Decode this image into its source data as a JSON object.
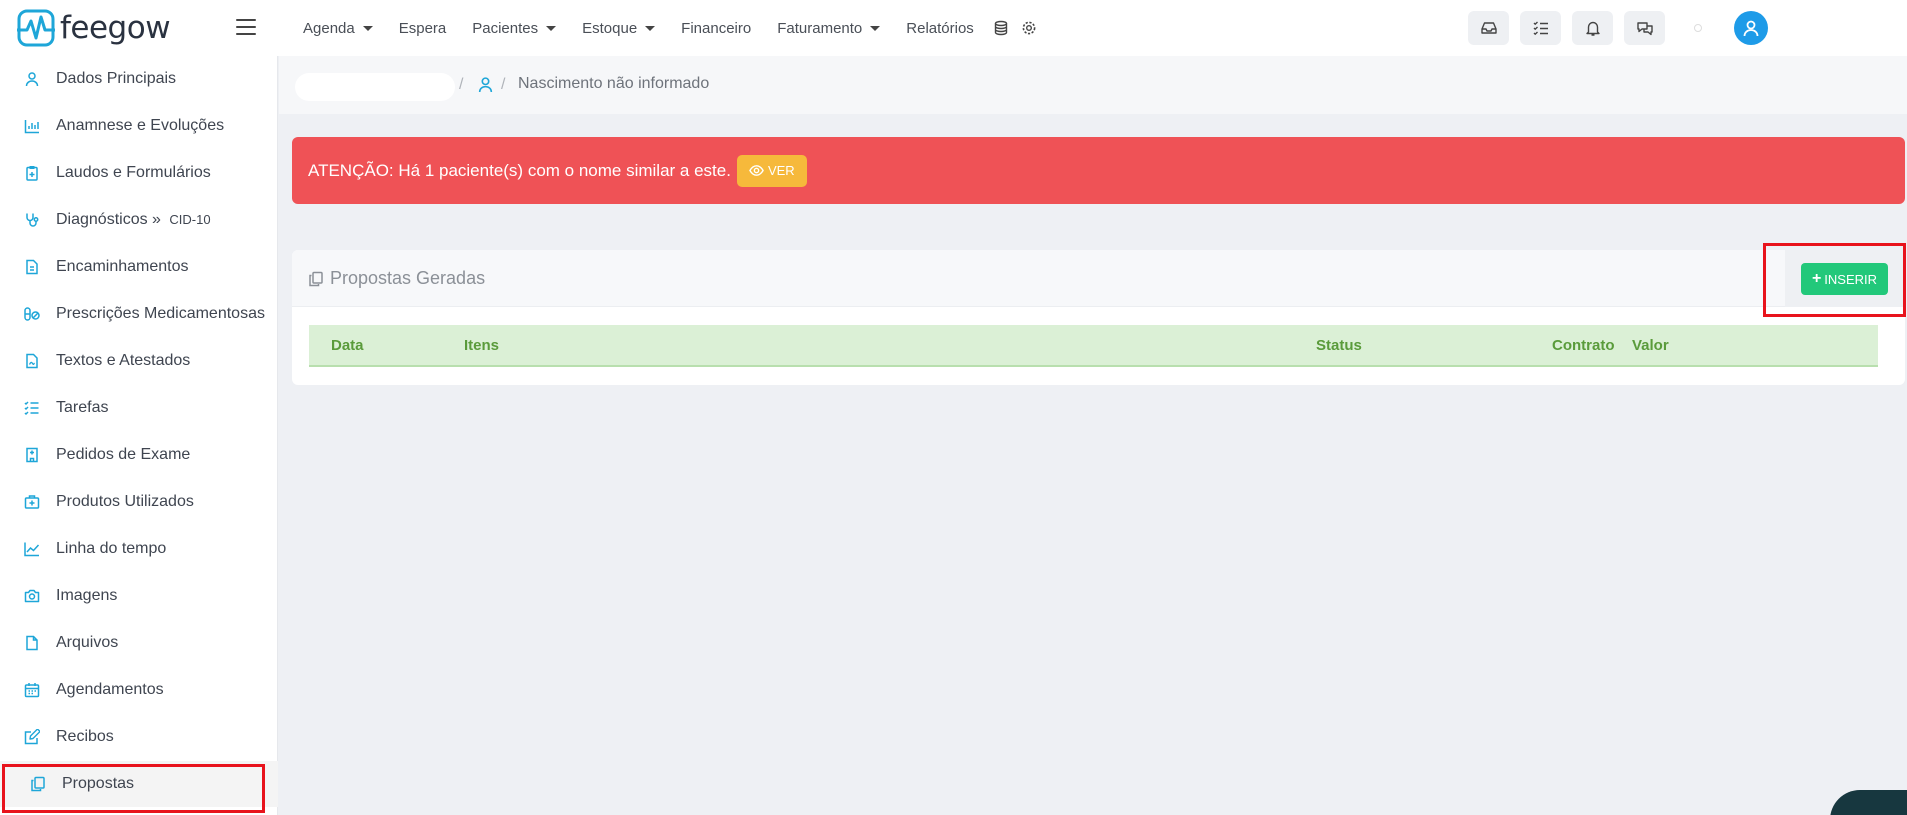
{
  "app": {
    "logo_text": "feegow",
    "brand_color": "#1ea6d8"
  },
  "nav": {
    "agenda": "Agenda",
    "espera": "Espera",
    "pacientes": "Pacientes",
    "estoque": "Estoque",
    "financeiro": "Financeiro",
    "faturamento": "Faturamento",
    "relatorios": "Relatórios"
  },
  "sidebar": {
    "items": [
      {
        "label": "Dados Principais",
        "icon": "user-icon"
      },
      {
        "label": "Anamnese e Evoluções",
        "icon": "chart-bar-icon"
      },
      {
        "label": "Laudos e Formulários",
        "icon": "clipboard-icon"
      },
      {
        "label": "Diagnósticos » ",
        "suffix": "CID-10",
        "icon": "stethoscope-icon"
      },
      {
        "label": "Encaminhamentos",
        "icon": "file-icon"
      },
      {
        "label": "Prescrições Medicamentosas",
        "icon": "pills-icon"
      },
      {
        "label": "Textos e Atestados",
        "icon": "file-signature-icon"
      },
      {
        "label": "Tarefas",
        "icon": "tasks-icon"
      },
      {
        "label": "Pedidos de Exame",
        "icon": "hospital-icon"
      },
      {
        "label": "Produtos Utilizados",
        "icon": "medkit-icon"
      },
      {
        "label": "Linha do tempo",
        "icon": "line-chart-icon"
      },
      {
        "label": "Imagens",
        "icon": "camera-icon"
      },
      {
        "label": "Arquivos",
        "icon": "file-icon"
      },
      {
        "label": "Agendamentos",
        "icon": "calendar-icon"
      },
      {
        "label": "Recibos",
        "icon": "edit-icon"
      },
      {
        "label": "Propostas",
        "icon": "copy-icon"
      }
    ]
  },
  "breadcrumb": {
    "separator": "/",
    "text": "Nascimento não informado"
  },
  "alert": {
    "text": "ATENÇÃO: Há 1 paciente(s) com o nome similar a este.",
    "button_label": "VER"
  },
  "panel": {
    "title": "Propostas Geradas",
    "insert_label": "INSERIR",
    "columns": [
      "Data",
      "Itens",
      "Status",
      "Contrato",
      "Valor"
    ]
  }
}
